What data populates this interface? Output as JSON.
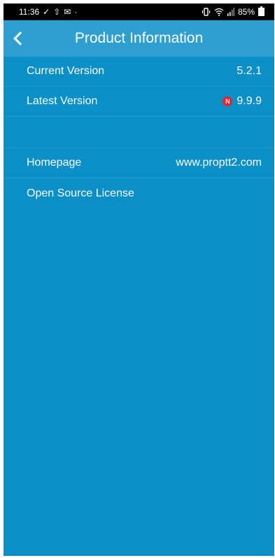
{
  "status_bar": {
    "time": "11:36",
    "left_icons": [
      "✓",
      "⇧",
      "✉",
      "·"
    ],
    "battery": "85%",
    "icons": [
      "vibrate-icon",
      "wifi-icon",
      "signal-icon",
      "battery-icon"
    ]
  },
  "header": {
    "title": "Product Information",
    "back_icon": "chevron-left-icon"
  },
  "rows": [
    {
      "label": "Current Version",
      "value": "5.2.1"
    },
    {
      "label": "Latest Version",
      "value": "9.9.9",
      "badge": "N"
    },
    {
      "label": "Homepage",
      "value": "www.proptt2.com"
    },
    {
      "label": "Open Source License",
      "value": ""
    }
  ],
  "colors": {
    "background": "#0a8fc7",
    "header": "#2d9fd1",
    "badge": "#e8232d"
  }
}
